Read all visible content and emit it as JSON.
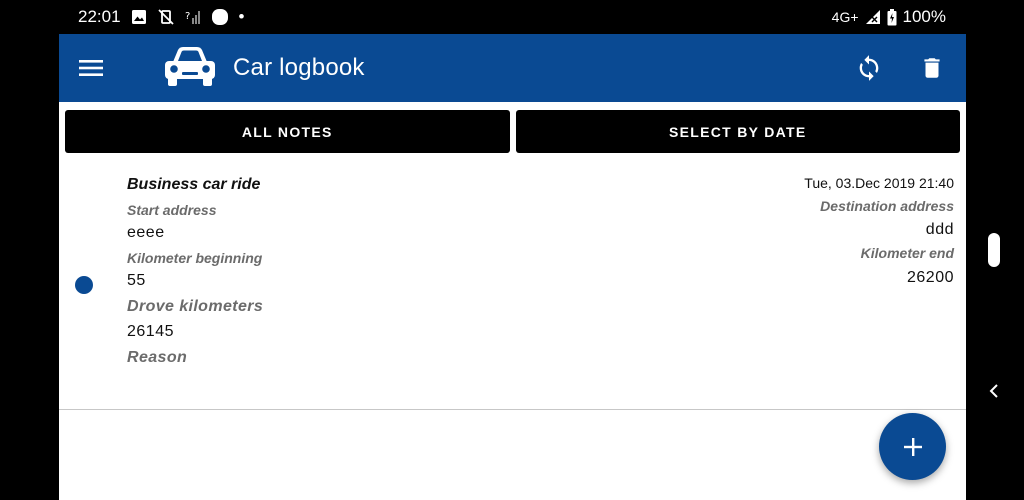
{
  "status_bar": {
    "time": "22:01",
    "network": "4G+",
    "battery_percent": "100%",
    "dot": "•",
    "left_icons": [
      "image-icon",
      "no-vibrate-icon",
      "no-signal-icon",
      "circle-app-icon"
    ],
    "right_icons": [
      "signal-icon",
      "battery-icon"
    ]
  },
  "app_bar": {
    "title": "Car logbook",
    "color": "#0a4a93",
    "icons": [
      "menu-icon",
      "car-icon",
      "sync-icon",
      "delete-icon"
    ]
  },
  "filters": {
    "all_notes": "ALL NOTES",
    "select_by_date": "SELECT BY DATE"
  },
  "entry": {
    "title": "Business car ride",
    "date": "Tue, 03.Dec 2019 21:40",
    "start_address_label": "Start address",
    "start_address": "eeee",
    "destination_address_label": "Destination address",
    "destination_address": "ddd",
    "km_beginning_label": "Kilometer beginning",
    "km_beginning": "55",
    "km_end_label": "Kilometer end",
    "km_end": "26200",
    "drove_km_label": "Drove kilometers",
    "drove_km": "26145",
    "reason_label": "Reason"
  },
  "fab": {
    "icon": "plus-icon"
  },
  "system_nav": {
    "icons": [
      "back-chevron-icon"
    ]
  }
}
